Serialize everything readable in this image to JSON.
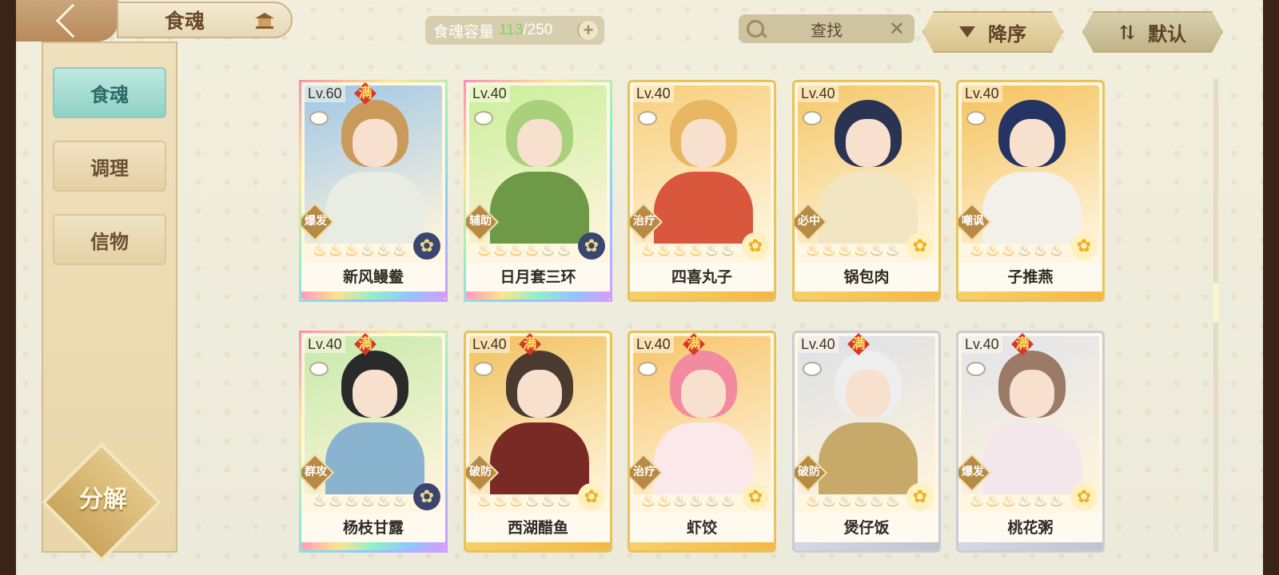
{
  "header": {
    "title": "食魂",
    "capacity_label": "食魂容量",
    "capacity_current": "113",
    "capacity_max": "/250",
    "search_label": "查找",
    "sort_desc_label": "降序",
    "sort_default_label": "默认"
  },
  "sidebar": {
    "items": [
      {
        "label": "食魂",
        "active": true
      },
      {
        "label": "调理",
        "active": false
      },
      {
        "label": "信物",
        "active": false
      }
    ],
    "decompose_label": "分解"
  },
  "badge_full": "满",
  "cards": [
    {
      "level": "Lv.60",
      "full": true,
      "role": "爆发",
      "name": "新风鳗鲞",
      "stars_on": 3,
      "stars_total": 6,
      "frame": "rainbow",
      "bg": "#9fc7e6",
      "hair": "#c99a5a",
      "body": "#e9ece3",
      "flower": "dark"
    },
    {
      "level": "Lv.40",
      "full": false,
      "role": "辅助",
      "name": "日月套三环",
      "stars_on": 4,
      "stars_total": 6,
      "frame": "rainbow",
      "bg": "#c9ef9a",
      "hair": "#a9d07a",
      "body": "#6e9a47",
      "flower": "dark"
    },
    {
      "level": "Lv.40",
      "full": false,
      "role": "治疗",
      "name": "四喜丸子",
      "stars_on": 4,
      "stars_total": 6,
      "frame": "gold",
      "bg": "#f7cf7c",
      "hair": "#e7b764",
      "body": "#d9573c",
      "flower": "gold"
    },
    {
      "level": "Lv.40",
      "full": false,
      "role": "必中",
      "name": "锅包肉",
      "stars_on": 4,
      "stars_total": 6,
      "frame": "gold",
      "bg": "#f4c869",
      "hair": "#2b3352",
      "body": "#f1e5c2",
      "flower": "gold"
    },
    {
      "level": "Lv.40",
      "full": false,
      "role": "嘲讽",
      "name": "子推燕",
      "stars_on": 3,
      "stars_total": 6,
      "frame": "gold",
      "bg": "#f5c25c",
      "hair": "#253463",
      "body": "#f3f0ea",
      "flower": "gold"
    },
    {
      "level": "Lv.40",
      "full": true,
      "role": "群攻",
      "name": "杨枝甘露",
      "stars_on": 0,
      "stars_total": 6,
      "frame": "rainbow",
      "bg": "#c6eaaa",
      "hair": "#2a2a2a",
      "body": "#8ab3cf",
      "flower": "dark"
    },
    {
      "level": "Lv.40",
      "full": true,
      "role": "破防",
      "name": "西湖醋鱼",
      "stars_on": 3,
      "stars_total": 6,
      "frame": "gold",
      "bg": "#f0c25f",
      "hair": "#4a3a30",
      "body": "#7a2a24",
      "flower": "gold"
    },
    {
      "level": "Lv.40",
      "full": true,
      "role": "治疗",
      "name": "虾饺",
      "stars_on": 2,
      "stars_total": 6,
      "frame": "gold",
      "bg": "#f6c46a",
      "hair": "#f28aa0",
      "body": "#fbe8ea",
      "flower": "gold"
    },
    {
      "level": "Lv.40",
      "full": true,
      "role": "破防",
      "name": "煲仔饭",
      "stars_on": 1,
      "stars_total": 6,
      "frame": "silver",
      "bg": "#dde0e6",
      "hair": "#eeeeee",
      "body": "#c7aa6a",
      "flower": "gold"
    },
    {
      "level": "Lv.40",
      "full": true,
      "role": "爆发",
      "name": "桃花粥",
      "stars_on": 3,
      "stars_total": 6,
      "frame": "silver",
      "bg": "#e2e4ea",
      "hair": "#9b7a66",
      "body": "#f3e7ec",
      "flower": "gold"
    }
  ],
  "colors": {
    "accent_gold": "#e8c25a",
    "active_tab": "#8ed1c6",
    "badge_red": "#d6382a",
    "capacity_green": "#7ed36b"
  }
}
